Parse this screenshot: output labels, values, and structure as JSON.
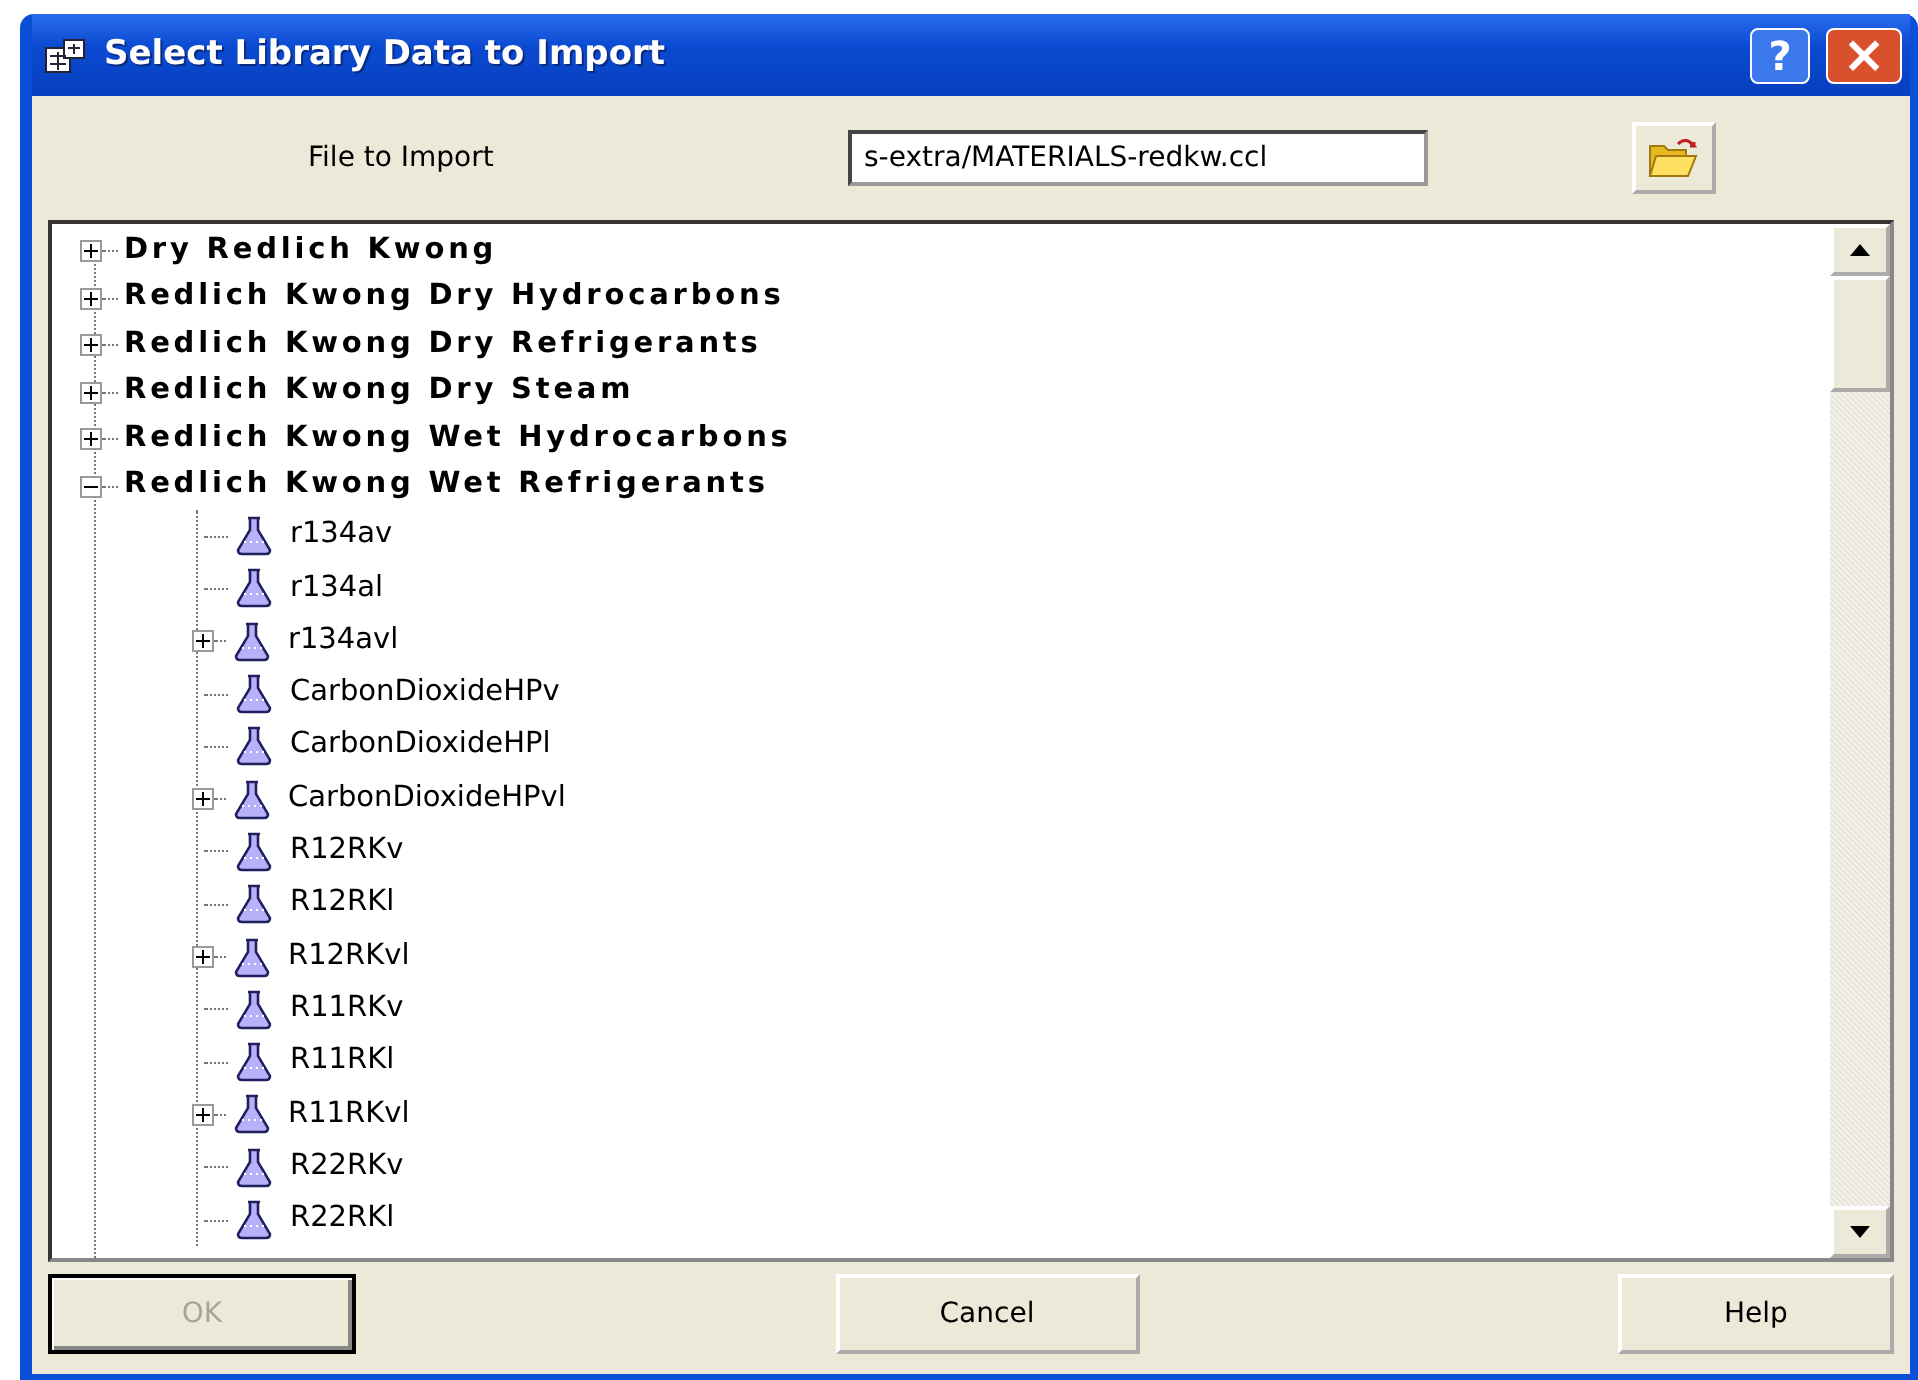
{
  "window": {
    "title": "Select Library Data to Import",
    "help_button": "?",
    "close_button": "×"
  },
  "file_row": {
    "label": "File to Import",
    "value": "s-extra/MATERIALS-redkw.ccl"
  },
  "tree": [
    {
      "label": "Dry Redlich Kwong",
      "expanded": false
    },
    {
      "label": "Redlich Kwong Dry Hydrocarbons",
      "expanded": false
    },
    {
      "label": "Redlich Kwong Dry Refrigerants",
      "expanded": false
    },
    {
      "label": "Redlich Kwong Dry Steam",
      "expanded": false
    },
    {
      "label": "Redlich Kwong Wet Hydrocarbons",
      "expanded": false
    },
    {
      "label": "Redlich Kwong Wet Refrigerants",
      "expanded": true,
      "children": [
        {
          "label": "r134av",
          "kind": "leaf"
        },
        {
          "label": "r134al",
          "kind": "leaf"
        },
        {
          "label": "r134avl",
          "kind": "node",
          "expanded": false
        },
        {
          "label": "CarbonDioxideHPv",
          "kind": "leaf"
        },
        {
          "label": "CarbonDioxideHPl",
          "kind": "leaf"
        },
        {
          "label": "CarbonDioxideHPvl",
          "kind": "node",
          "expanded": false
        },
        {
          "label": "R12RKv",
          "kind": "leaf"
        },
        {
          "label": "R12RKl",
          "kind": "leaf"
        },
        {
          "label": "R12RKvl",
          "kind": "node",
          "expanded": false
        },
        {
          "label": "R11RKv",
          "kind": "leaf"
        },
        {
          "label": "R11RKl",
          "kind": "leaf"
        },
        {
          "label": "R11RKvl",
          "kind": "node",
          "expanded": false
        },
        {
          "label": "R22RKv",
          "kind": "leaf"
        },
        {
          "label": "R22RKl",
          "kind": "leaf"
        }
      ]
    }
  ],
  "buttons": [
    {
      "label": "OK",
      "disabled": true,
      "default": true
    },
    {
      "label": "Cancel",
      "disabled": false,
      "default": false
    },
    {
      "label": "Help",
      "disabled": false,
      "default": false
    }
  ]
}
